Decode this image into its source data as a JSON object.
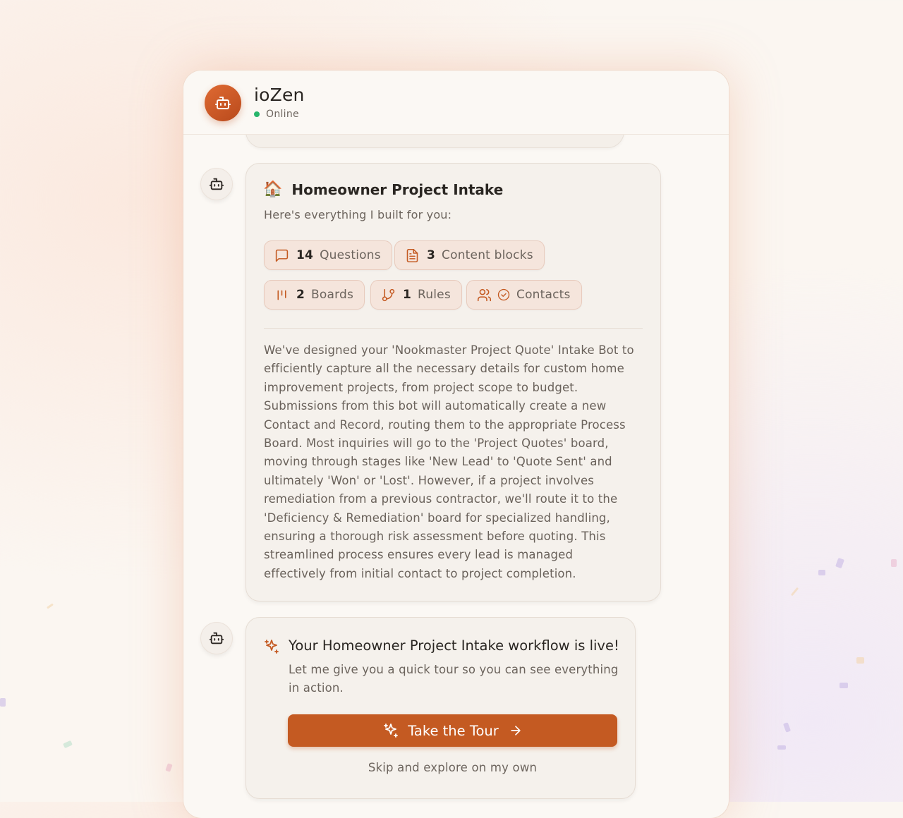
{
  "header": {
    "avatar_icon": "robot-icon",
    "app_title": "ioZen",
    "status": "Online",
    "status_color": "#27b56b"
  },
  "summary_card": {
    "emoji": "🏠",
    "title": "Homeowner Project Intake",
    "subtitle": "Here's everything I built for you:",
    "chips": [
      {
        "icon": "message-square-icon",
        "count": "14",
        "label": "Questions"
      },
      {
        "icon": "document-icon",
        "count": "3",
        "label": "Content blocks"
      },
      {
        "icon": "kanban-icon",
        "count": "2",
        "label": "Boards"
      },
      {
        "icon": "git-branch-icon",
        "count": "1",
        "label": "Rules"
      },
      {
        "icon": "users-check-icon",
        "count": "",
        "label": "Contacts"
      }
    ],
    "description": "We've designed your 'Nookmaster Project Quote' Intake Bot to efficiently capture all the necessary details for custom home improvement projects, from project scope to budget. Submissions from this bot will automatically create a new Contact and Record, routing them to the appropriate Process Board. Most inquiries will go to the 'Project Quotes' board, moving through stages like 'New Lead' to 'Quote Sent' and ultimately 'Won' or 'Lost'. However, if a project involves remediation from a previous contractor, we'll route it to the 'Deficiency & Remediation' board for specialized handling, ensuring a thorough risk assessment before quoting. This streamlined process ensures every lead is managed effectively from initial contact to project completion."
  },
  "live_card": {
    "icon": "sparkles-icon",
    "title": "Your Homeowner Project Intake workflow is live!",
    "text": "Let me give you a quick tour so you can see everything in action.",
    "button_label": "Take the Tour",
    "skip_label": "Skip and explore on my own"
  },
  "colors": {
    "accent": "#c45a22",
    "chip_background": "#f5e5dc",
    "card_background": "#f5f1ec"
  }
}
